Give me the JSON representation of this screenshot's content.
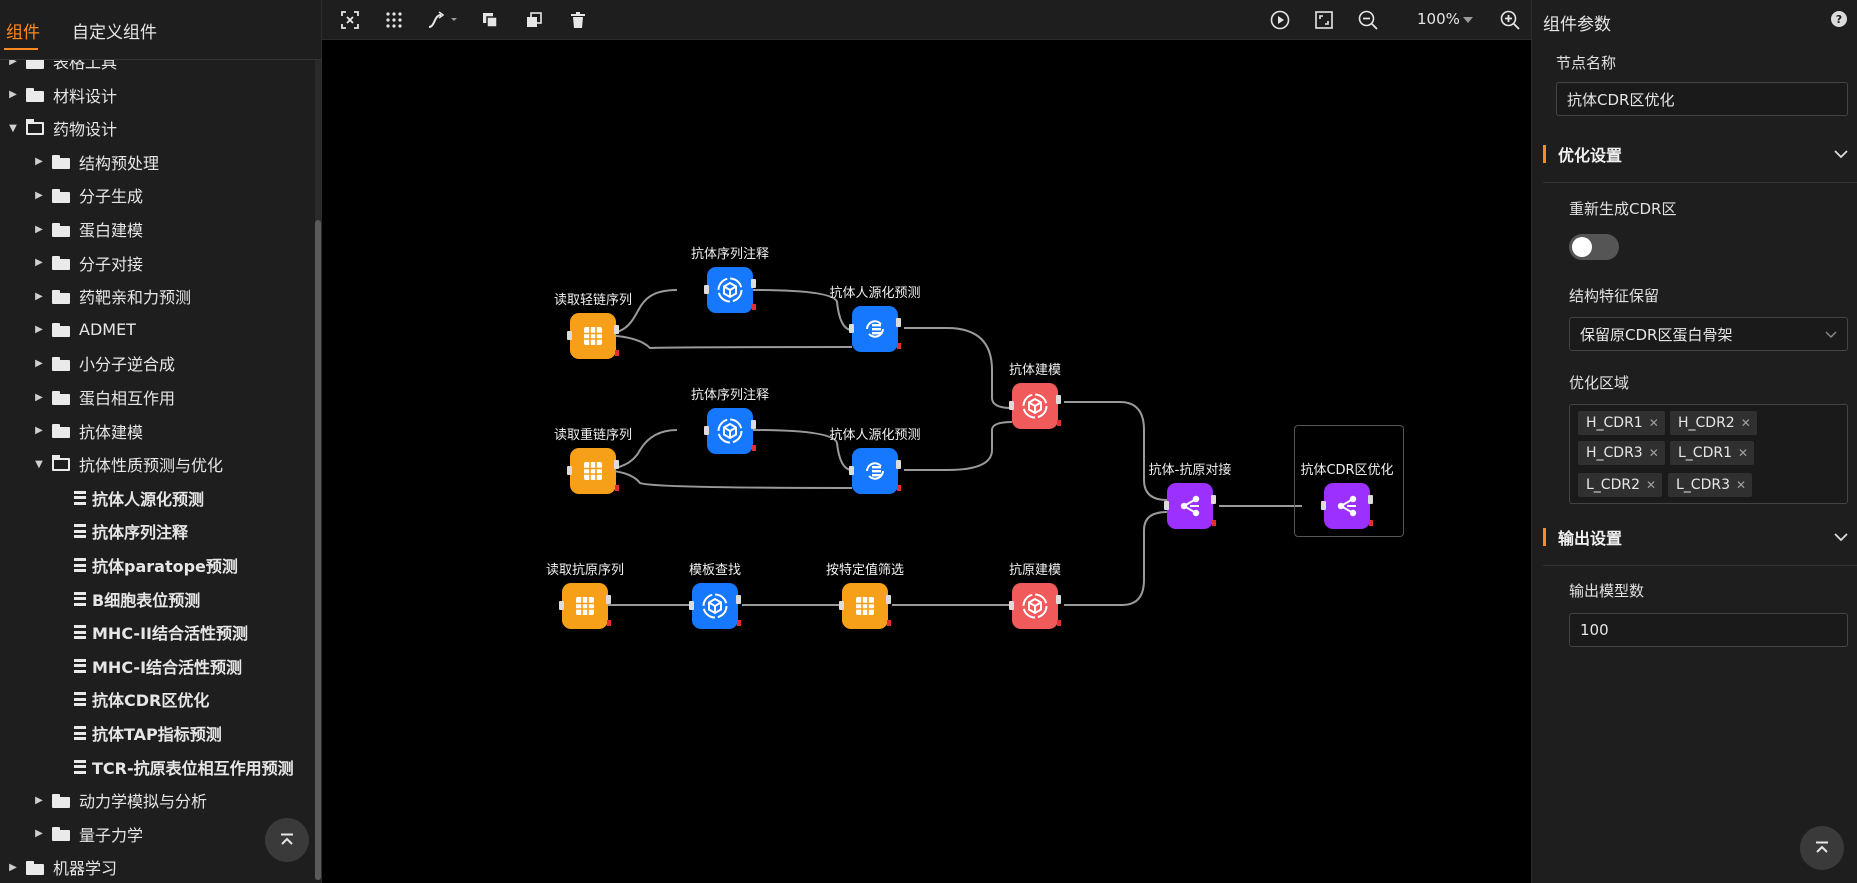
{
  "sidebar": {
    "tabs": [
      "组件",
      "自定义组件"
    ],
    "tree": [
      {
        "label": "表格工具",
        "level": 0,
        "type": "folder",
        "expanded": false
      },
      {
        "label": "材料设计",
        "level": 0,
        "type": "folder",
        "expanded": false
      },
      {
        "label": "药物设计",
        "level": 0,
        "type": "folder",
        "expanded": true
      },
      {
        "label": "结构预处理",
        "level": 1,
        "type": "folder",
        "expanded": false
      },
      {
        "label": "分子生成",
        "level": 1,
        "type": "folder",
        "expanded": false
      },
      {
        "label": "蛋白建模",
        "level": 1,
        "type": "folder",
        "expanded": false
      },
      {
        "label": "分子对接",
        "level": 1,
        "type": "folder",
        "expanded": false
      },
      {
        "label": "药靶亲和力预测",
        "level": 1,
        "type": "folder",
        "expanded": false
      },
      {
        "label": "ADMET",
        "level": 1,
        "type": "folder",
        "expanded": false
      },
      {
        "label": "小分子逆合成",
        "level": 1,
        "type": "folder",
        "expanded": false
      },
      {
        "label": "蛋白相互作用",
        "level": 1,
        "type": "folder",
        "expanded": false
      },
      {
        "label": "抗体建模",
        "level": 1,
        "type": "folder",
        "expanded": false
      },
      {
        "label": "抗体性质预测与优化",
        "level": 1,
        "type": "folder",
        "expanded": true
      },
      {
        "label": "抗体人源化预测",
        "level": 2,
        "type": "item"
      },
      {
        "label": "抗体序列注释",
        "level": 2,
        "type": "item"
      },
      {
        "label": "抗体paratope预测",
        "level": 2,
        "type": "item"
      },
      {
        "label": "B细胞表位预测",
        "level": 2,
        "type": "item"
      },
      {
        "label": "MHC-II结合活性预测",
        "level": 2,
        "type": "item"
      },
      {
        "label": "MHC-I结合活性预测",
        "level": 2,
        "type": "item"
      },
      {
        "label": "抗体CDR区优化",
        "level": 2,
        "type": "item"
      },
      {
        "label": "抗体TAP指标预测",
        "level": 2,
        "type": "item"
      },
      {
        "label": "TCR-抗原表位相互作用预测",
        "level": 2,
        "type": "item"
      },
      {
        "label": "动力学模拟与分析",
        "level": 1,
        "type": "folder",
        "expanded": false
      },
      {
        "label": "量子力学",
        "level": 1,
        "type": "folder",
        "expanded": false
      },
      {
        "label": "机器学习",
        "level": 0,
        "type": "folder",
        "expanded": false
      }
    ]
  },
  "toolbar": {
    "zoom": "100%",
    "icons": [
      "fit-selection-icon",
      "grid-icon",
      "connector-style-icon",
      "copy-icon",
      "paste-icon",
      "delete-icon",
      "run-icon",
      "fullscreen-icon",
      "zoom-out-icon",
      "zoom-in-icon"
    ]
  },
  "canvas": {
    "nodes": [
      {
        "id": "n1",
        "label": "读取轻链序列",
        "color": "orange",
        "icon": "table-icon"
      },
      {
        "id": "n2",
        "label": "抗体序列注释",
        "color": "blue",
        "icon": "cube-cycle-icon"
      },
      {
        "id": "n3",
        "label": "抗体人源化预测",
        "color": "blue",
        "icon": "list-cycle-icon"
      },
      {
        "id": "n4",
        "label": "读取重链序列",
        "color": "orange",
        "icon": "table-icon"
      },
      {
        "id": "n5",
        "label": "抗体序列注释",
        "color": "blue",
        "icon": "cube-cycle-icon"
      },
      {
        "id": "n6",
        "label": "抗体人源化预测",
        "color": "blue",
        "icon": "list-cycle-icon"
      },
      {
        "id": "n7",
        "label": "抗体建模",
        "color": "red",
        "icon": "cube-cycle-icon"
      },
      {
        "id": "n8",
        "label": "读取抗原序列",
        "color": "orange",
        "icon": "table-icon"
      },
      {
        "id": "n9",
        "label": "模板查找",
        "color": "blue",
        "icon": "cube-cycle-icon"
      },
      {
        "id": "n10",
        "label": "按特定值筛选",
        "color": "orange",
        "icon": "table-icon"
      },
      {
        "id": "n11",
        "label": "抗原建模",
        "color": "red",
        "icon": "cube-cycle-icon"
      },
      {
        "id": "n12",
        "label": "抗体-抗原对接",
        "color": "purple",
        "icon": "share-icon"
      },
      {
        "id": "n13",
        "label": "抗体CDR区优化",
        "color": "purple",
        "icon": "share-icon"
      }
    ]
  },
  "panel": {
    "title": "组件参数",
    "node_name_label": "节点名称",
    "node_name_value": "抗体CDR区优化",
    "optimize_section": "优化设置",
    "regen_label": "重新生成CDR区",
    "regen_on": false,
    "keep_label": "结构特征保留",
    "keep_value": "保留原CDR区蛋白骨架",
    "region_label": "优化区域",
    "regions": [
      "H_CDR1",
      "H_CDR2",
      "H_CDR3",
      "L_CDR1",
      "L_CDR2",
      "L_CDR3"
    ],
    "output_section": "输出设置",
    "models_label": "输出模型数",
    "models_value": "100"
  },
  "colors": {
    "accent": "#ff8a1f",
    "orange": "#f6a019",
    "blue": "#1677ff",
    "red": "#f15a5a",
    "purple": "#9b30ff"
  }
}
